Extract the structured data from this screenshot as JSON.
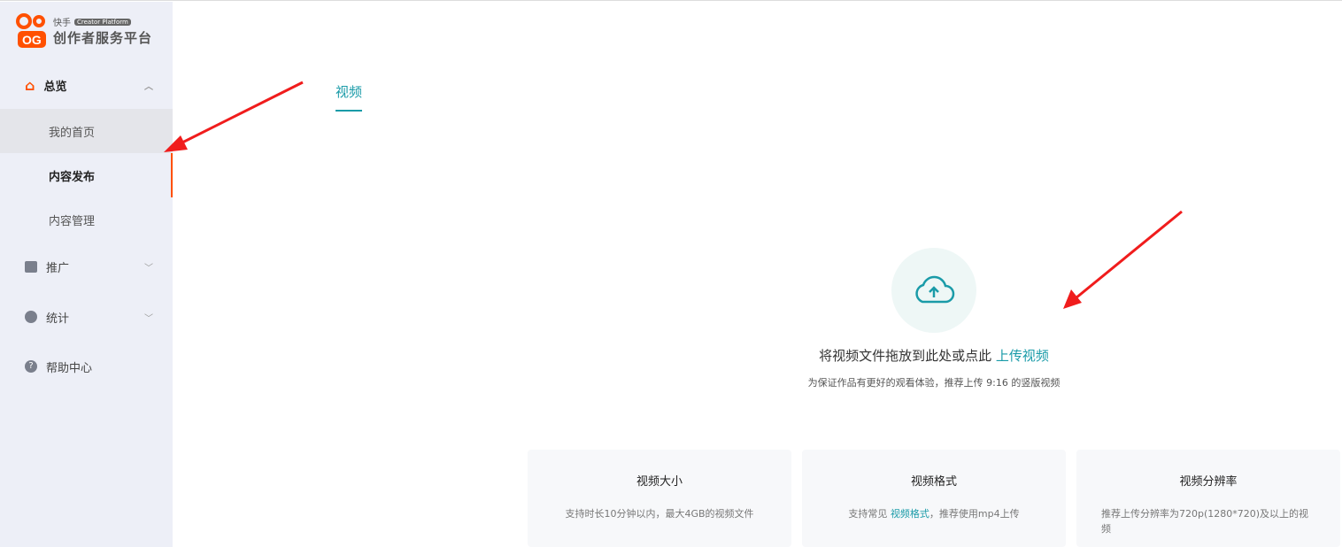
{
  "logo": {
    "brand": "快手",
    "badge": "Creator Platform",
    "title": "创作者服务平台"
  },
  "sidebar": {
    "overview": "总览",
    "home": "我的首页",
    "publish": "内容发布",
    "manage": "内容管理",
    "promote": "推广",
    "stats": "统计",
    "help": "帮助中心"
  },
  "tabs": {
    "video": "视频"
  },
  "upload": {
    "prompt": "将视频文件拖放到此处或点此",
    "link": "上传视频",
    "hint": "为保证作品有更好的观看体验，推荐上传 9:16 的竖版视频"
  },
  "cards": [
    {
      "title": "视频大小",
      "desc": "支持时长10分钟以内，最大4GB的视频文件"
    },
    {
      "title": "视频格式",
      "desc_pre": "支持常见 ",
      "desc_link": "视频格式",
      "desc_post": "，推荐使用mp4上传"
    },
    {
      "title": "视频分辨率",
      "desc": "推荐上传分辨率为720p(1280*720)及以上的视频"
    }
  ],
  "colors": {
    "accent": "#1a9ba8",
    "brand": "#ff5000",
    "arrow": "#f01c1c"
  }
}
